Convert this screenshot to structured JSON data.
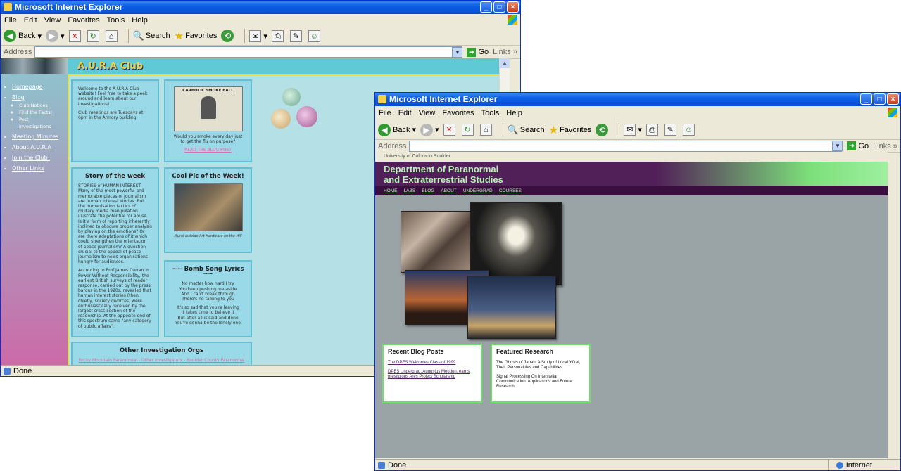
{
  "browser": {
    "title": "Microsoft Internet Explorer",
    "menu": [
      "File",
      "Edit",
      "View",
      "Favorites",
      "Tools",
      "Help"
    ],
    "back": "Back",
    "search": "Search",
    "favorites": "Favorites",
    "address_label": "Address",
    "go": "Go",
    "links": "Links",
    "status_done": "Done",
    "zone": "Internet"
  },
  "aura": {
    "title": "A.U.R.A Club",
    "nav": {
      "homepage": "Homepage",
      "blog": "Blog",
      "club_notices": "Club Notices",
      "find_facts": "Find the Facts!",
      "post": "Post",
      "investigations": "Investigations",
      "meeting_minutes": "Meeting Minutes",
      "about": "About A.U.R.A",
      "join": "Join the Club!",
      "other_links": "Other Links"
    },
    "welcome": {
      "p1": "Welcome to the A.U.R.A Club website! Feel free to take a peek around and learn about our investigations!",
      "p2": "Club meetings are Tuesdays at 6pm in the Armory building"
    },
    "smokeball": {
      "poster_title": "CARBOLIC SMOKE BALL",
      "caption": "Would you smoke every day just to get the flu on purpose?",
      "link": "READ THE BLOG POST"
    },
    "story": {
      "heading": "Story of the week",
      "p1": "STORIES of HUMAN INTEREST Many of the most powerful and memorable pieces of journalism are human interest stories. But the humanisation tactics of military media manipulation illustrate the potential for abuse. Is it a form of reporting inherently inclined to obscure proper analysis by playing on the emotions? Or are there adaptations of it which could strengthen the orientation of peace journalism? A question crucial to the appeal of peace journalism to news organisations hungry for audiences.",
      "p2": "According to Prof James Curran in Power Without Responsibility, the earliest British surveys of reader response, carried out by the press barons in the 1920s, revealed that human interest stories (then, chiefly, society divorces) were enthusiastically received by the largest cross-section of the readership. At the opposite end of this spectrum came \"any category of public affairs\"."
    },
    "cool_pic": {
      "heading": "Cool Pic of the Week!",
      "caption": "Mural outside Art Hardware on the Hill"
    },
    "bomb_song": {
      "heading": "~~ Bomb Song Lyrics ~~",
      "lines": [
        "No matter how hard I try",
        "You keep pushing me aside",
        "And I can't break through",
        "There's no talking to you"
      ],
      "lines2": [
        "It's so sad that you're leaving",
        "It takes time to believe it",
        "But after all is said and done",
        "You're gonna be the lonely one"
      ]
    },
    "other_orgs": {
      "heading": "Other Investigation Orgs",
      "links": "Rocky Mountain Paranormal - Other Investigators - Boulder County Paranormal -"
    }
  },
  "dpes": {
    "university": "University of Colorado Boulder",
    "title_line1": "Department of Paranormal",
    "title_line2": "and Extraterrestrial Studies",
    "nav": [
      "HOME",
      "LABS",
      "BLOG",
      "ABOUT",
      "UNDERGRAD",
      "COURSES"
    ],
    "blog": {
      "heading": "Recent Blog Posts",
      "post1": "The DPES Welcomes Class of 1999",
      "post2": "DPES Undergrad, Augustus Meudon, earns prestigious Ares Project Scholarship"
    },
    "research": {
      "heading": "Featured Research",
      "item1": "The Ghosts of Japan: A Study of Local Yūrei, Their Personalities and Capabilities",
      "item2": "Signal Processing On Interstellar Communication: Applications and Future Research"
    }
  }
}
